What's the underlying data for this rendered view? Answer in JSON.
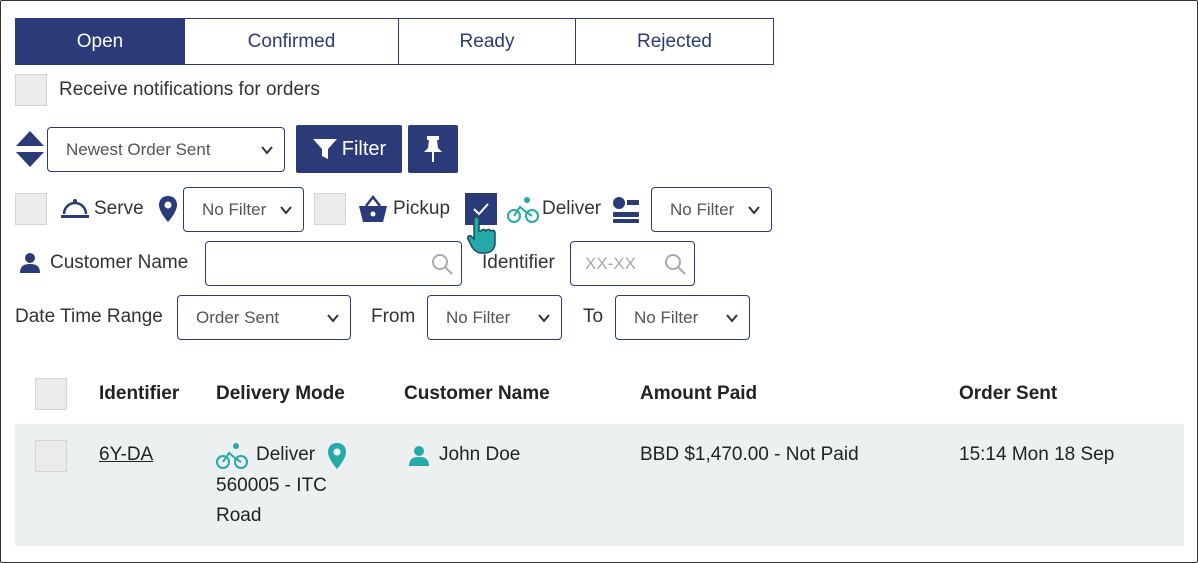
{
  "tabs": [
    {
      "label": "Open",
      "active": true
    },
    {
      "label": "Confirmed",
      "active": false
    },
    {
      "label": "Ready",
      "active": false
    },
    {
      "label": "Rejected",
      "active": false
    }
  ],
  "notifications": {
    "label": "Receive notifications for orders",
    "checked": false
  },
  "sort": {
    "selected": "Newest Order Sent"
  },
  "filter_button": {
    "label": "Filter"
  },
  "modes": {
    "serve": {
      "label": "Serve",
      "checked": false
    },
    "serve_location_select": "No Filter",
    "pickup": {
      "label": "Pickup",
      "checked": false
    },
    "deliver": {
      "label": "Deliver",
      "checked": true
    },
    "deliver_filter_select": "No Filter"
  },
  "customer_name": {
    "label": "Customer Name",
    "value": ""
  },
  "identifier": {
    "label": "Identifier",
    "placeholder": "XX-XX"
  },
  "date_range": {
    "label": "Date Time Range",
    "selected": "Order Sent",
    "from_label": "From",
    "from_selected": "No Filter",
    "to_label": "To",
    "to_selected": "No Filter"
  },
  "table": {
    "headers": [
      "Identifier",
      "Delivery Mode",
      "Customer Name",
      "Amount Paid",
      "Order Sent"
    ],
    "rows": [
      {
        "identifier": "6Y-DA",
        "mode": "Deliver",
        "address_line1": "560005 - ITC",
        "address_line2": "Road",
        "customer": "John Doe",
        "amount": "BBD $1,470.00 - Not Paid",
        "order_sent": "15:14 Mon 18 Sep"
      }
    ]
  },
  "colors": {
    "primary": "#2b3a78",
    "teal": "#26a9a9",
    "row_bg": "#edf0f1"
  }
}
